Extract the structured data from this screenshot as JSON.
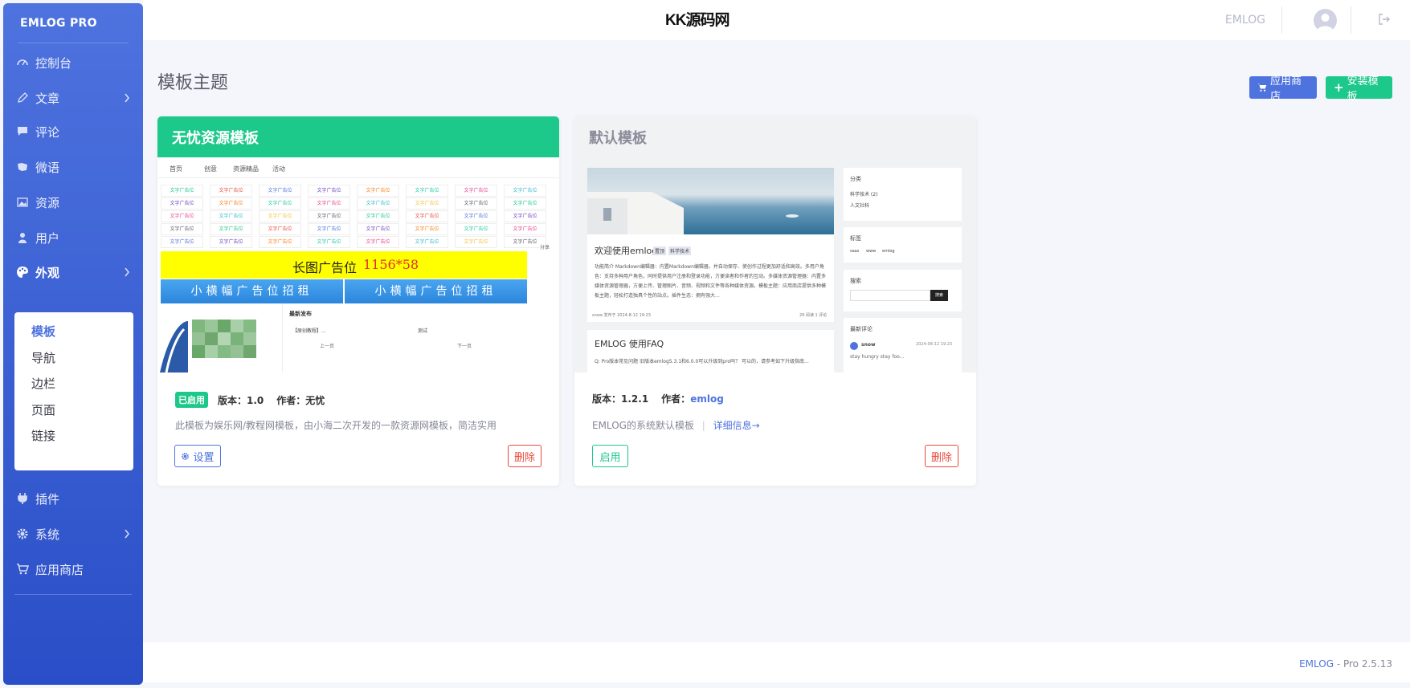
{
  "sidebar": {
    "brand": "EMLOG PRO",
    "items": [
      {
        "label": "控制台",
        "icon": "dashboard-icon"
      },
      {
        "label": "文章",
        "icon": "pencil-icon",
        "has_children": true
      },
      {
        "label": "评论",
        "icon": "comment-icon"
      },
      {
        "label": "微语",
        "icon": "twitter-icon"
      },
      {
        "label": "资源",
        "icon": "image-icon"
      },
      {
        "label": "用户",
        "icon": "user-icon"
      },
      {
        "label": "外观",
        "icon": "palette-icon",
        "has_children": true,
        "active": true
      },
      {
        "label": "插件",
        "icon": "plug-icon"
      },
      {
        "label": "系统",
        "icon": "gear-icon",
        "has_children": true
      },
      {
        "label": "应用商店",
        "icon": "cart-icon"
      }
    ],
    "submenu": [
      {
        "label": "模板",
        "active": true
      },
      {
        "label": "导航"
      },
      {
        "label": "边栏"
      },
      {
        "label": "页面"
      },
      {
        "label": "链接"
      }
    ]
  },
  "topbar": {
    "logo": "KK源码网",
    "user": "EMLOG"
  },
  "page": {
    "title": "模板主题",
    "store_button": "应用商店",
    "install_button": "安装模板"
  },
  "templates": [
    {
      "name": "无忧资源模板",
      "status": "已启用",
      "version": "版本：1.0",
      "author_label": "作者：",
      "author": "无忧",
      "description": "此模板为娱乐网/教程网模板，由小海二次开发的一款资源网模板，简洁实用",
      "settings_button": "设置",
      "delete_button": "删除",
      "preview": {
        "nav": [
          "首页",
          "创意",
          "资源精品",
          "活动"
        ],
        "cells": [
          "文字广告位",
          "文字广告位",
          "文字广告位",
          "文字广告位",
          "文字广告位",
          "文字广告位",
          "文字广告位",
          "文字广告位"
        ],
        "banner_text": "长图广告位",
        "banner_size": "1156*58",
        "small_ad": "小横幅广告位招租",
        "latest_title": "最新发布",
        "latest_item1": "【原创教程】...",
        "latest_item2": "测试",
        "prev": "上一页",
        "next": "下一页",
        "share": "分享"
      }
    },
    {
      "name": "默认模板",
      "version": "版本：1.2.1",
      "author_label": "作者：",
      "author": "emlog",
      "description": "EMLOG的系统默认模板",
      "detail_link": "详细信息→",
      "enable_button": "启用",
      "delete_button": "删除",
      "preview": {
        "post1_title": "欢迎使用emlog",
        "post1_tags": [
          "置顶",
          "科学技术"
        ],
        "post1_body": "功能简介 Markdown编辑器：内置Markdown编辑器，并自动保存、使创作过程更加舒适和高效。多用户角色：支持多种用户角色，同时提供用户注册和登录功能，方便读者和作者的互动。多媒体资源管理器：内置多媒体资源管理器，方便上传、管理图片、音频、视频和文件等各种媒体资源。模板主题：应用商店提供多种模板主题，轻松打造独具个性的站点。插件生态：拥有强大...",
        "post1_meta": "snow 发布于 2024-8-12 19:23",
        "post1_stats": "29 阅读 1 评论",
        "post2_title": "EMLOG 使用FAQ",
        "post2_body": "Q: Pro版本常见问题 旧版本emlog5.3.1和6.0.0可以升级到pro吗？ 可以的，请参考如下升级指南...",
        "side_category_title": "分类",
        "side_category_items": [
          "科学技术 (2)",
          "人文社科"
        ],
        "side_tag_title": "标签",
        "side_tags": [
          "saas",
          "www",
          "emlog"
        ],
        "side_search_title": "搜索",
        "side_search_button": "搜索",
        "side_comment_title": "最新评论",
        "side_comment_user": "snow",
        "side_comment_date": "2024-08-12 19:23",
        "side_comment_text": "stay hungry stay foo..."
      }
    }
  ],
  "footer": {
    "brand": "EMLOG",
    "version": " - Pro 2.5.13"
  },
  "colors": {
    "primary": "#4e73df",
    "success": "#1cc88a",
    "danger": "#e74a3b"
  }
}
